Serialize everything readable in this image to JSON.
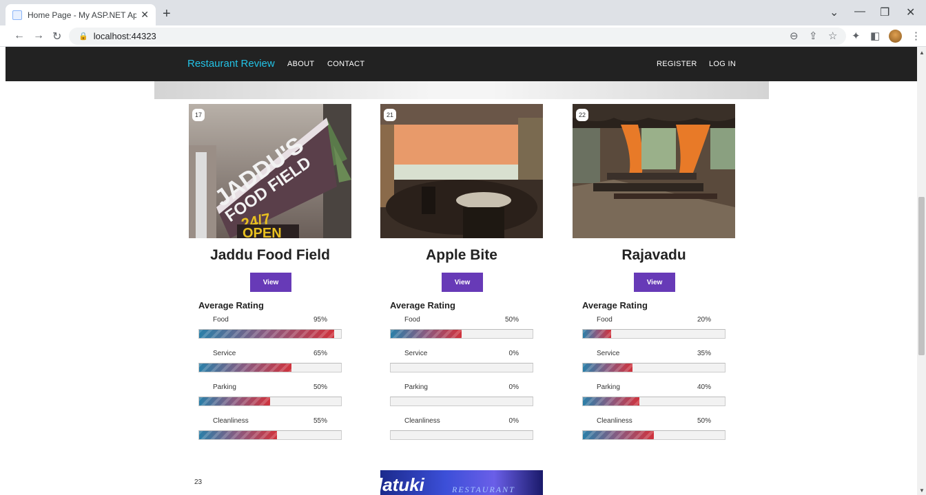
{
  "browser": {
    "tab_title": "Home Page - My ASP.NET Applic",
    "tab_close": "✕",
    "new_tab": "+",
    "url": "localhost:44323",
    "lock": "🔒"
  },
  "nav": {
    "brand": "Restaurant Review",
    "links": [
      "ABOUT",
      "CONTACT"
    ],
    "right_links": [
      "REGISTER",
      "LOG IN"
    ]
  },
  "restaurants": [
    {
      "id": "17",
      "name": "Jaddu Food Field",
      "view_label": "View",
      "rating_title": "Average Rating",
      "ratings": [
        {
          "label": "Food",
          "value": "95%",
          "pct": 95
        },
        {
          "label": "Service",
          "value": "65%",
          "pct": 65
        },
        {
          "label": "Parking",
          "value": "50%",
          "pct": 50
        },
        {
          "label": "Cleanliness",
          "value": "55%",
          "pct": 55
        }
      ],
      "photo_text": [
        "JADDU'S",
        "FOOD FIELD",
        "24/7",
        "OPEN"
      ]
    },
    {
      "id": "21",
      "name": "Apple Bite",
      "view_label": "View",
      "rating_title": "Average Rating",
      "ratings": [
        {
          "label": "Food",
          "value": "50%",
          "pct": 50
        },
        {
          "label": "Service",
          "value": "0%",
          "pct": 0
        },
        {
          "label": "Parking",
          "value": "0%",
          "pct": 0
        },
        {
          "label": "Cleanliness",
          "value": "0%",
          "pct": 0
        }
      ]
    },
    {
      "id": "22",
      "name": "Rajavadu",
      "view_label": "View",
      "rating_title": "Average Rating",
      "ratings": [
        {
          "label": "Food",
          "value": "20%",
          "pct": 20
        },
        {
          "label": "Service",
          "value": "35%",
          "pct": 35
        },
        {
          "label": "Parking",
          "value": "40%",
          "pct": 40
        },
        {
          "label": "Cleanliness",
          "value": "50%",
          "pct": 50
        }
      ]
    }
  ],
  "next_item": {
    "id": "23",
    "photo_text": "latuki",
    "photo_subtext": "RESTAURANT"
  },
  "colors": {
    "accent": "#673ab7",
    "brand": "#22c3e6",
    "navbar": "#222222"
  }
}
